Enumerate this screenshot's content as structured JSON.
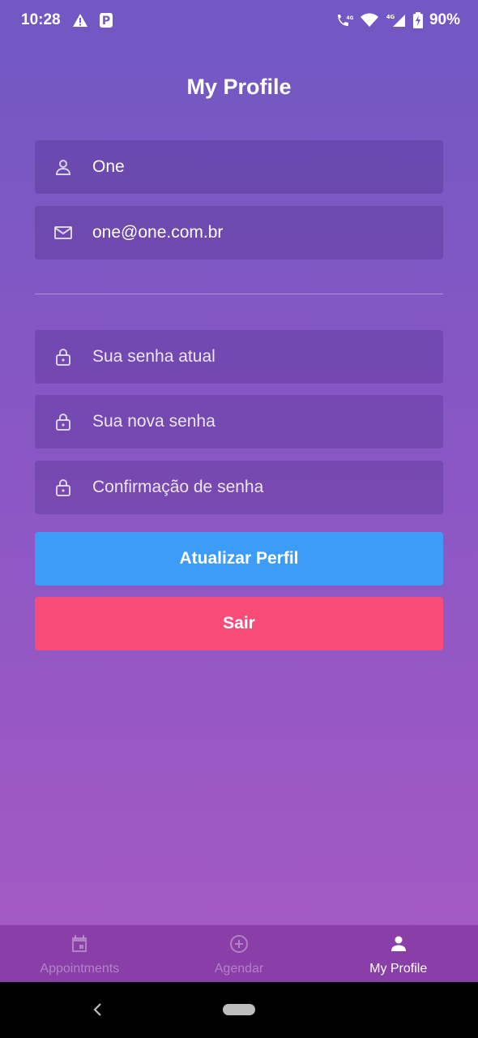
{
  "status_bar": {
    "time": "10:28",
    "battery": "90%",
    "network_label": "4G",
    "left_icons": [
      "warning-icon",
      "parking-icon"
    ],
    "right_icons": [
      "call-volte-icon",
      "wifi-icon",
      "signal-icon",
      "battery-charging-icon"
    ]
  },
  "header": {
    "title": "My Profile"
  },
  "form": {
    "name": {
      "icon": "user-icon",
      "value": "One"
    },
    "email": {
      "icon": "mail-icon",
      "value": "one@one.com.br"
    },
    "current_password": {
      "icon": "lock-icon",
      "placeholder": "Sua senha atual"
    },
    "new_password": {
      "icon": "lock-icon",
      "placeholder": "Sua nova senha"
    },
    "confirm_password": {
      "icon": "lock-icon",
      "placeholder": "Confirmação de senha"
    },
    "update_label": "Atualizar Perfil",
    "logout_label": "Sair"
  },
  "colors": {
    "update_button": "#3d9cf7",
    "logout_button": "#f74c78",
    "bottom_nav": "#8a3ea8",
    "background_top": "#7158c3",
    "background_bottom": "#a95ac4"
  },
  "bottom_nav": {
    "items": [
      {
        "label": "Appointments",
        "icon": "calendar-icon",
        "active": false
      },
      {
        "label": "Agendar",
        "icon": "add-circle-icon",
        "active": false
      },
      {
        "label": "My Profile",
        "icon": "person-icon",
        "active": true
      }
    ]
  },
  "system_nav": {
    "back": "back-icon",
    "home": "home-pill"
  }
}
